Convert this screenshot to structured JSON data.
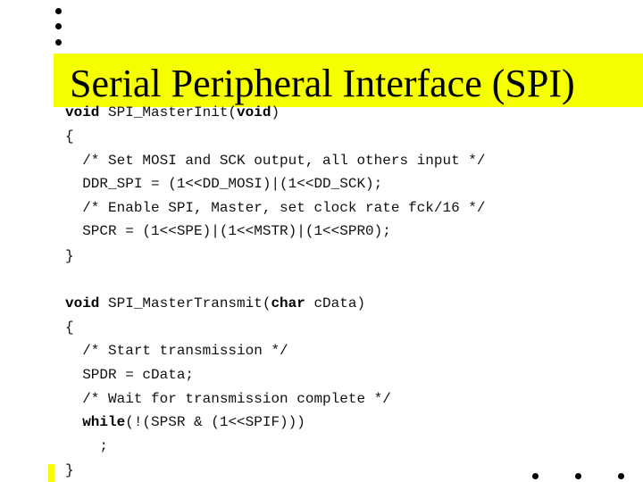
{
  "slide": {
    "title": "Serial Peripheral Interface (SPI)",
    "colors": {
      "title_highlight": "#f5ff00",
      "text": "#000000",
      "background": "#ffffff"
    },
    "decorations": [
      "bullet-dot",
      "bullet-dot",
      "bullet-dot",
      "bullet-dot",
      "bullet-dot",
      "bullet-dot"
    ]
  },
  "code": {
    "lines": [
      {
        "kw": "void",
        "text": " SPI_MasterInit(",
        "kw2": "void",
        "tail": ")"
      },
      {
        "text": "{"
      },
      {
        "text": "  /* Set MOSI and SCK output, all others input */"
      },
      {
        "text": "  DDR_SPI = (1<<DD_MOSI)|(1<<DD_SCK);"
      },
      {
        "text": "  /* Enable SPI, Master, set clock rate fck/16 */"
      },
      {
        "text": "  SPCR = (1<<SPE)|(1<<MSTR)|(1<<SPR0);"
      },
      {
        "text": "}"
      },
      {
        "text": ""
      },
      {
        "kw": "void",
        "text": " SPI_MasterTransmit(",
        "kw2": "char",
        "tail": " cData)"
      },
      {
        "text": "{"
      },
      {
        "text": "  /* Start transmission */"
      },
      {
        "text": "  SPDR = cData;"
      },
      {
        "text": "  /* Wait for transmission complete */"
      },
      {
        "pre": "  ",
        "kw": "while",
        "text": "(!(SPSR & (1<<SPIF)))"
      },
      {
        "text": "    ;"
      },
      {
        "text": "}"
      }
    ]
  }
}
